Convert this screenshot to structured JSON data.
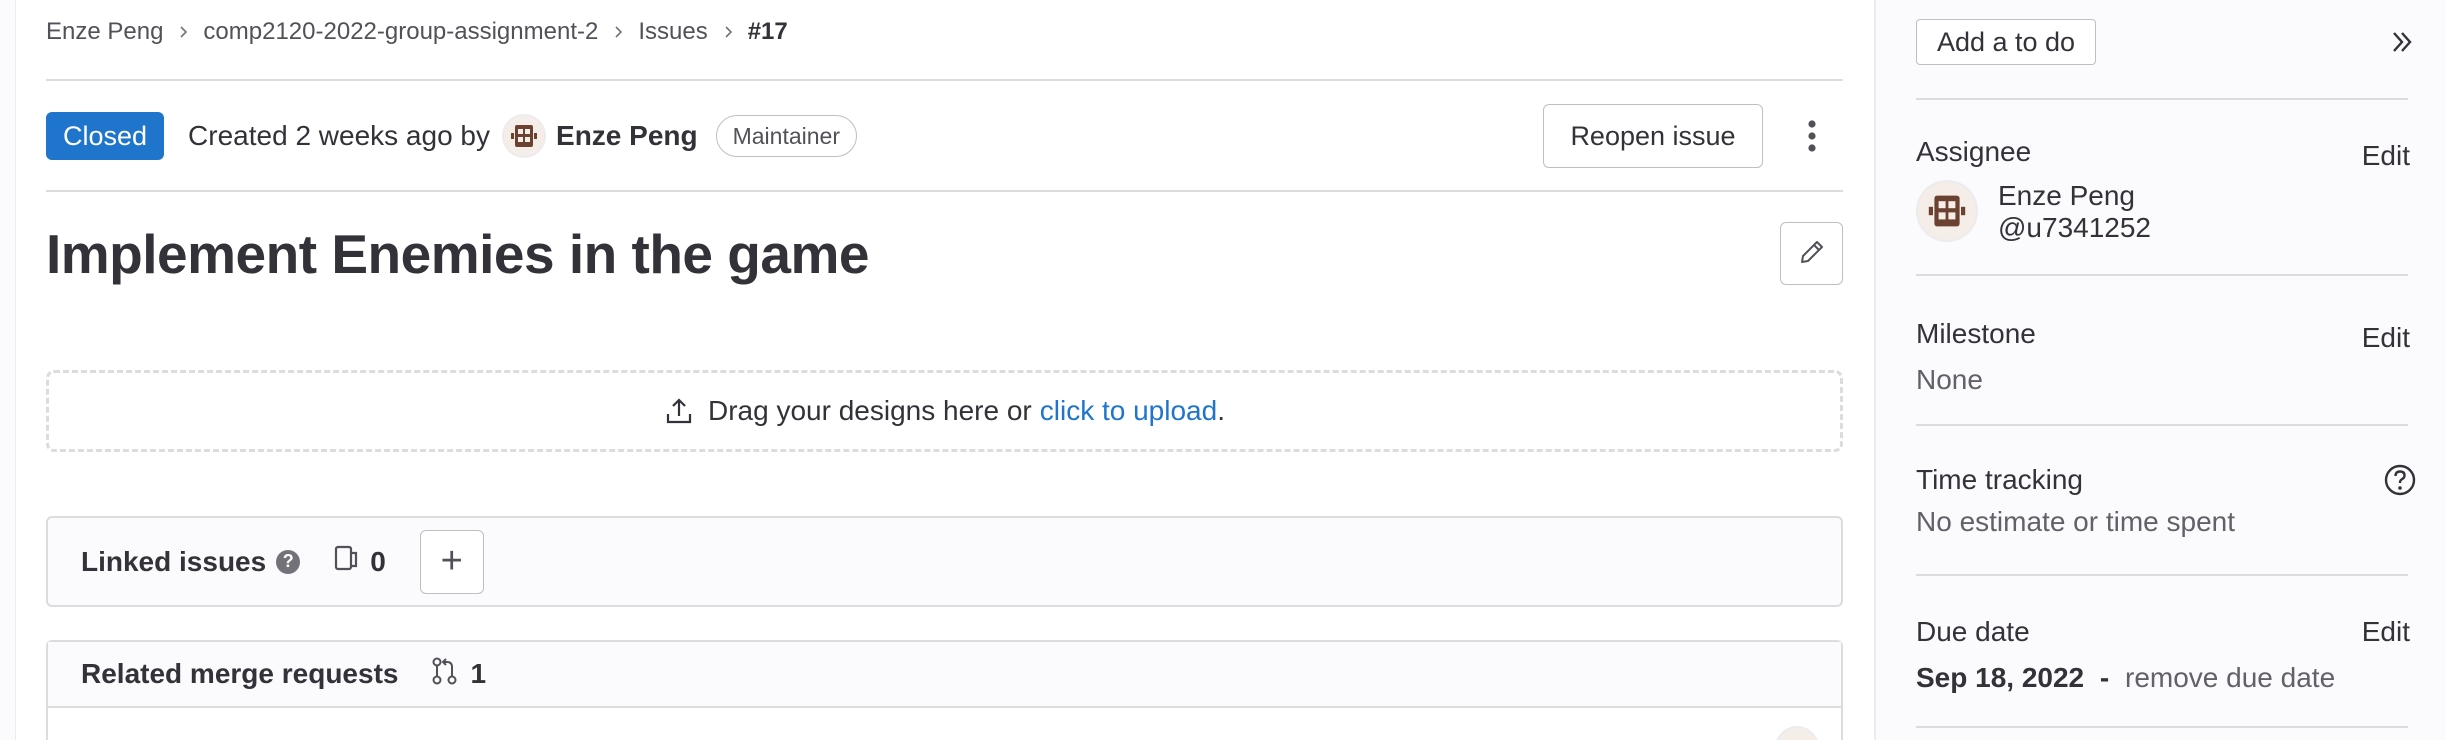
{
  "breadcrumb": {
    "items": [
      "Enze Peng",
      "comp2120-2022-group-assignment-2",
      "Issues"
    ],
    "current": "#17"
  },
  "issue": {
    "status": "Closed",
    "created_text": "Created 2 weeks ago by",
    "author": "Enze Peng",
    "author_role": "Maintainer",
    "reopen_label": "Reopen issue",
    "title": "Implement Enemies in the game"
  },
  "designs": {
    "drop_text": "Drag your designs here or",
    "upload_link": "click to upload",
    "period": "."
  },
  "linked_issues": {
    "title": "Linked issues",
    "help": "?",
    "count": "0",
    "add_label": "+"
  },
  "related_mrs": {
    "title": "Related merge requests",
    "count": "1"
  },
  "sidebar": {
    "todo_label": "Add a to do",
    "assignee": {
      "label": "Assignee",
      "edit": "Edit",
      "name": "Enze Peng",
      "username": "@u7341252"
    },
    "milestone": {
      "label": "Milestone",
      "edit": "Edit",
      "value": "None"
    },
    "time_tracking": {
      "label": "Time tracking",
      "value": "No estimate or time spent"
    },
    "due_date": {
      "label": "Due date",
      "edit": "Edit",
      "value": "Sep 18, 2022",
      "separator": "-",
      "remove": "remove due date"
    }
  },
  "colors": {
    "status_closed": "#1f75cb",
    "link": "#1f75cb",
    "avatar_accent": "#6b4232"
  },
  "icons": [
    "chevron-right-icon",
    "avatar-icon",
    "kebab-icon",
    "pencil-icon",
    "upload-icon",
    "help-icon",
    "issue-icon",
    "plus-icon",
    "merge-request-icon",
    "double-chevron-right-icon",
    "question-circle-icon"
  ]
}
